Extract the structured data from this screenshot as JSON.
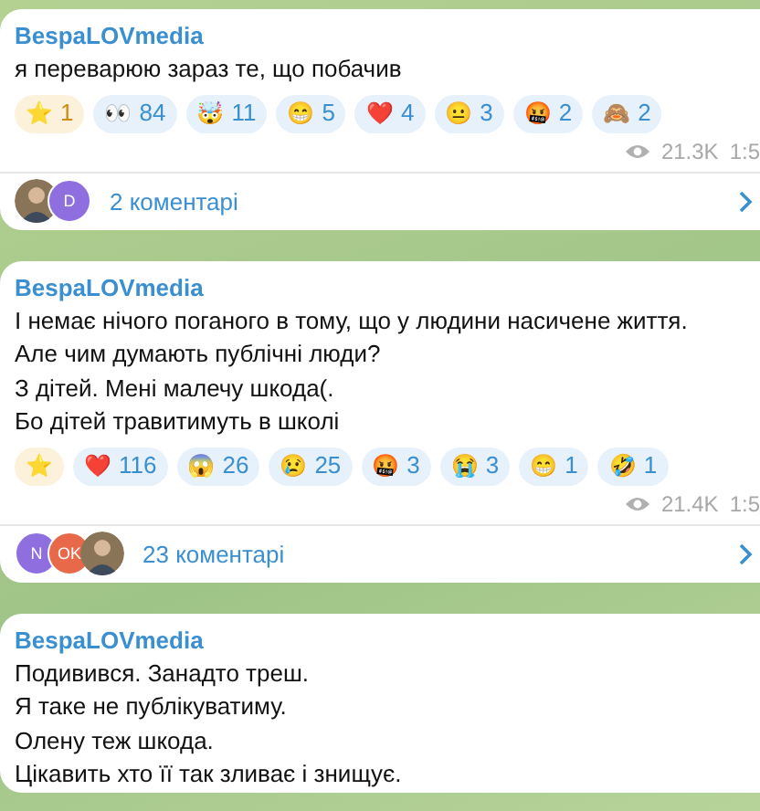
{
  "posts": [
    {
      "author": "BespaLOVmedia",
      "lines": [
        "я переварюю зараз те, що побачив"
      ],
      "reactions": [
        {
          "kind": "star",
          "emoji": "⭐",
          "count": "1"
        },
        {
          "kind": "emoji",
          "emoji": "👀",
          "count": "84"
        },
        {
          "kind": "emoji",
          "emoji": "🤯",
          "count": "11"
        },
        {
          "kind": "emoji",
          "emoji": "😁",
          "count": "5"
        },
        {
          "kind": "emoji",
          "emoji": "❤️",
          "count": "4"
        },
        {
          "kind": "emoji",
          "emoji": "😐",
          "count": "3"
        },
        {
          "kind": "emoji",
          "emoji": "🤬",
          "count": "2"
        },
        {
          "kind": "emoji",
          "emoji": "🙈",
          "count": "2"
        }
      ],
      "views": "21.3K",
      "time": "1:5",
      "commenters": [
        {
          "kind": "photo"
        },
        {
          "kind": "letter",
          "letter": "D",
          "color": "#8f6fe0"
        }
      ],
      "comments": "2 коментарі"
    },
    {
      "author": "BespaLOVmedia",
      "lines": [
        "І немає нічого поганого в тому, що у людини насичене життя.",
        "Але чим думають публічні люди?",
        "З дітей. Мені малечу шкода(.",
        "Бо дітей травитимуть в школі"
      ],
      "reactions": [
        {
          "kind": "star",
          "emoji": "⭐"
        },
        {
          "kind": "emoji",
          "emoji": "❤️",
          "count": "116"
        },
        {
          "kind": "emoji",
          "emoji": "😱",
          "count": "26"
        },
        {
          "kind": "emoji",
          "emoji": "😢",
          "count": "25"
        },
        {
          "kind": "emoji",
          "emoji": "🤬",
          "count": "3"
        },
        {
          "kind": "emoji",
          "emoji": "😭",
          "count": "3"
        },
        {
          "kind": "emoji",
          "emoji": "😁",
          "count": "1"
        },
        {
          "kind": "emoji",
          "emoji": "🤣",
          "count": "1"
        }
      ],
      "views": "21.4K",
      "time": "1:5",
      "commenters": [
        {
          "kind": "letter",
          "letter": "N",
          "color": "#8f6fe0"
        },
        {
          "kind": "letter",
          "letter": "OK",
          "color": "#e8684a"
        },
        {
          "kind": "photo"
        }
      ],
      "comments": "23 коментарі"
    },
    {
      "author": "BespaLOVmedia",
      "lines": [
        "Подивився. Занадто треш.",
        "Я таке не публікуватиму.",
        "Олену теж шкода.",
        "Цікавить хто її так зливає і знищує."
      ]
    }
  ]
}
